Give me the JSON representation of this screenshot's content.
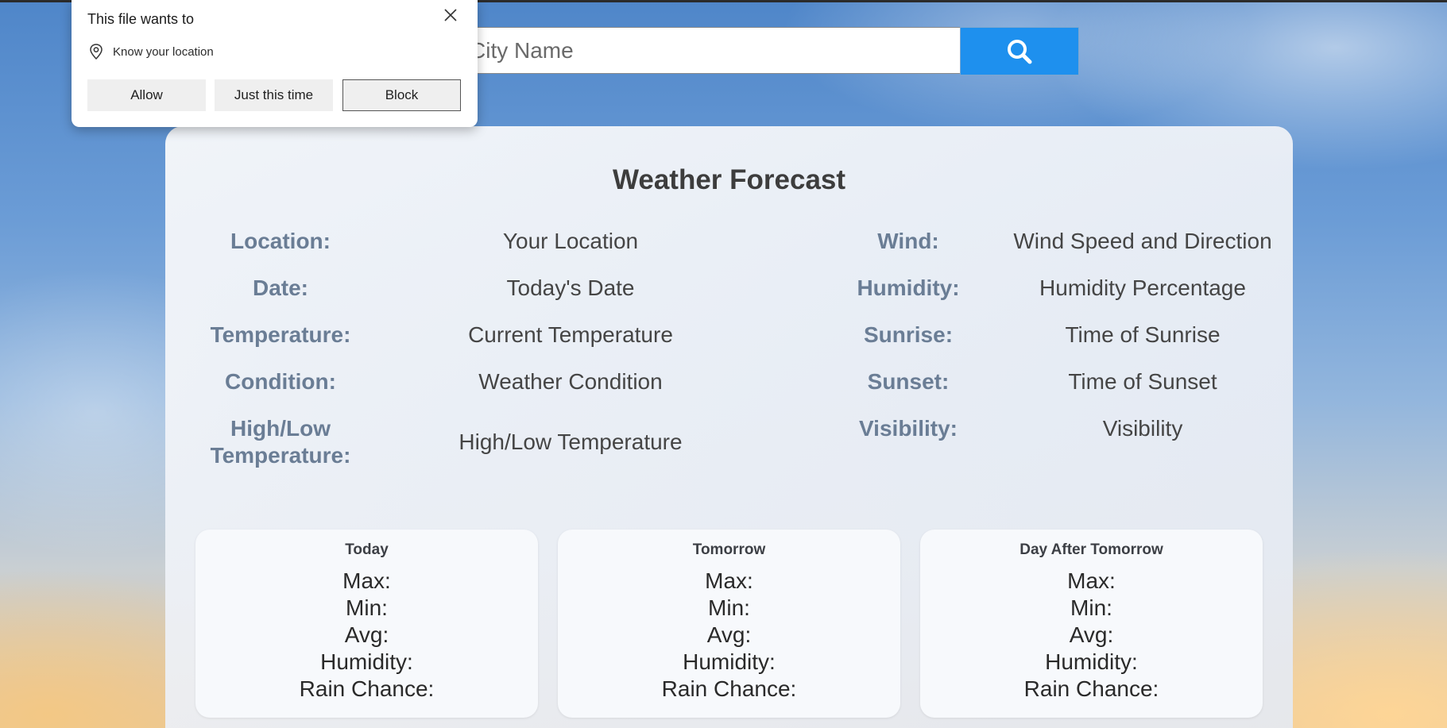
{
  "search": {
    "placeholder": "City Name"
  },
  "permission_popup": {
    "title": "This file wants to",
    "permission": "Know your location",
    "buttons": {
      "allow": "Allow",
      "just_this_time": "Just this time",
      "block": "Block"
    }
  },
  "card": {
    "title": "Weather Forecast",
    "left_rows": [
      {
        "label": "Location:",
        "value": "Your Location"
      },
      {
        "label": "Date:",
        "value": "Today's Date"
      },
      {
        "label": "Temperature:",
        "value": "Current Temperature"
      },
      {
        "label": "Condition:",
        "value": "Weather Condition"
      },
      {
        "label": "High/Low Temperature:",
        "value": "High/Low Temperature"
      }
    ],
    "right_rows": [
      {
        "label": "Wind:",
        "value": "Wind Speed and Direction"
      },
      {
        "label": "Humidity:",
        "value": "Humidity Percentage"
      },
      {
        "label": "Sunrise:",
        "value": "Time of Sunrise"
      },
      {
        "label": "Sunset:",
        "value": "Time of Sunset"
      },
      {
        "label": "Visibility:",
        "value": "Visibility"
      }
    ]
  },
  "forecast": [
    {
      "title": "Today",
      "max": "Max:",
      "min": "Min:",
      "avg": "Avg:",
      "humidity": "Humidity:",
      "rain": "Rain Chance:"
    },
    {
      "title": "Tomorrow",
      "max": "Max:",
      "min": "Min:",
      "avg": "Avg:",
      "humidity": "Humidity:",
      "rain": "Rain Chance:"
    },
    {
      "title": "Day After Tomorrow",
      "max": "Max:",
      "min": "Min:",
      "avg": "Avg:",
      "humidity": "Humidity:",
      "rain": "Rain Chance:"
    }
  ],
  "colors": {
    "accent": "#1e90ee",
    "label": "#6a7d95"
  },
  "icons": {
    "search": "search-icon",
    "close": "close-icon",
    "location": "location-pin-icon"
  }
}
